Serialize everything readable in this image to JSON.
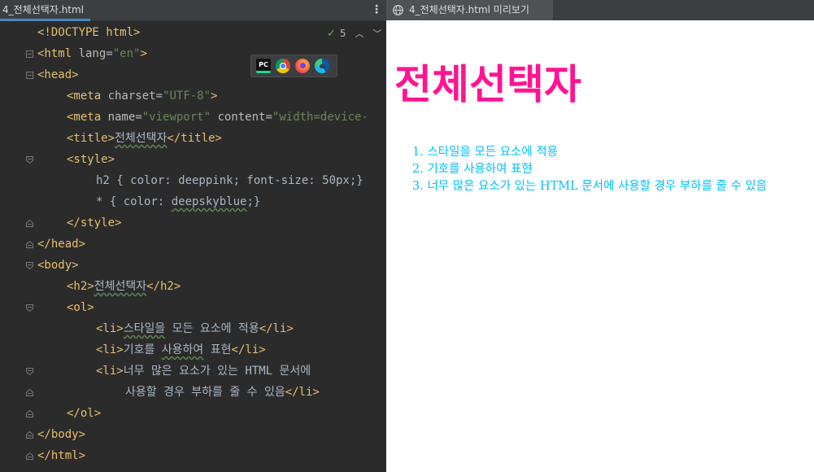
{
  "editor": {
    "tab_label": "4_전체선택자.html",
    "menu_glyph": "⋮",
    "inspection": {
      "check": "✓",
      "count": "5",
      "up": "︿",
      "down": "﹀"
    },
    "browser_icons": {
      "pc_label": "PC",
      "names": [
        "pycharm-icon",
        "chrome-icon",
        "firefox-icon",
        "edge-icon"
      ]
    },
    "code": {
      "l1_a": "<!DOCTYPE html>",
      "l2_a": "<html ",
      "l2_b": "lang",
      "l2_c": "=",
      "l2_d": "\"en\"",
      "l2_e": ">",
      "l3_a": "<head>",
      "l4_a": "<meta ",
      "l4_b": "charset",
      "l4_c": "=",
      "l4_d": "\"UTF-8\"",
      "l4_e": ">",
      "l5_a": "<meta ",
      "l5_b": "name",
      "l5_c": "=",
      "l5_d": "\"viewport\"",
      "l5_e": " content",
      "l5_f": "=",
      "l5_g": "\"width=device-",
      "l6_a": "<title>",
      "l6_b": "전체선택자",
      "l6_c": "</title>",
      "l7_a": "<style>",
      "l8_a": "h2 { color: deeppink; font-size: 50px;}",
      "l9_a": "* { color: ",
      "l9_b": "deepskyblue",
      "l9_c": ";}",
      "l10_a": "</style>",
      "l11_a": "</head>",
      "l12_a": "<body>",
      "l13_a": "<h2>",
      "l13_b": "전체선택자",
      "l13_c": "</h2>",
      "l14_a": "<ol>",
      "l15_a": "<li>",
      "l15_b": "스타일을",
      "l15_c": " 모든 요소에 적용",
      "l15_d": "</li>",
      "l16_a": "<li>",
      "l16_b": "기호를 ",
      "l16_c": "사용하여",
      "l16_d": " 표현",
      "l16_e": "</li>",
      "l17_a": "<li>",
      "l17_b": "너무 많은 요소가 있는 HTML 문서에",
      "l18_a": "사용할 경우 부하를 줄 수 있음",
      "l18_b": "</li>",
      "l19_a": "</ol>",
      "l20_a": "</body>",
      "l21_a": "</html>"
    }
  },
  "preview": {
    "tab_label": "4_전체선택자.html 미리보기",
    "heading": "전체선택자",
    "heading_color": "#ff1493",
    "list_color": "#00bfff",
    "items": [
      "1. 스타일을 모든 요소에 적용",
      "2. 기호를 사용하여 표현",
      "3. 너무 많은 요소가 있는 HTML 문서에 사용할 경우 부하를 줄 수 있음"
    ]
  }
}
